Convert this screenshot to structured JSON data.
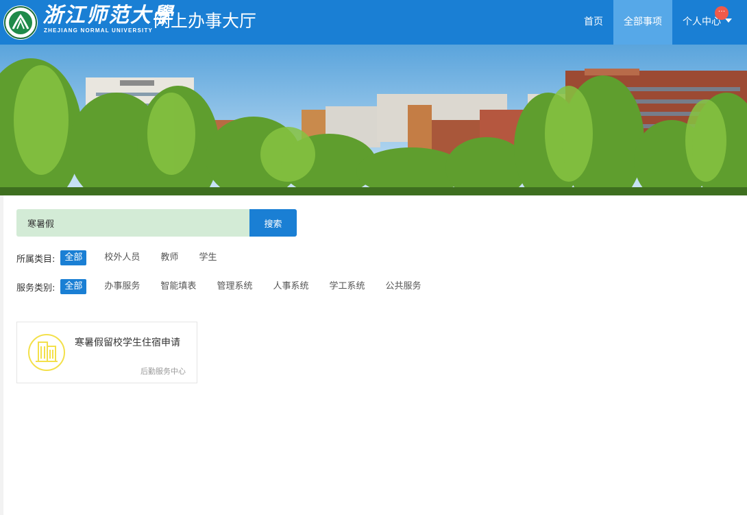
{
  "header": {
    "logo_cn": "浙江师范大學",
    "logo_en": "ZHEJIANG NORMAL UNIVERSITY",
    "site_title": "网上办事大厅",
    "nav": [
      {
        "label": "首页",
        "active": false
      },
      {
        "label": "全部事项",
        "active": true
      },
      {
        "label": "个人中心",
        "active": false
      }
    ],
    "badge": "···"
  },
  "search": {
    "value": "寒暑假",
    "button": "搜索"
  },
  "filters": {
    "category": {
      "label": "所属类目:",
      "options": [
        "全部",
        "校外人员",
        "教师",
        "学生"
      ],
      "selected": "全部"
    },
    "service": {
      "label": "服务类别:",
      "options": [
        "全部",
        "办事服务",
        "智能填表",
        "管理系统",
        "人事系统",
        "学工系统",
        "公共服务"
      ],
      "selected": "全部"
    }
  },
  "results": [
    {
      "title": "寒暑假留校学生住宿申请",
      "department": "后勤服务中心",
      "icon": "building-icon"
    }
  ],
  "colors": {
    "primary": "#1a7fd4",
    "nav_active": "#56a8e8",
    "search_bg": "#d3ebd6",
    "badge": "#f05a4a",
    "icon_yellow": "#f3e04a"
  }
}
